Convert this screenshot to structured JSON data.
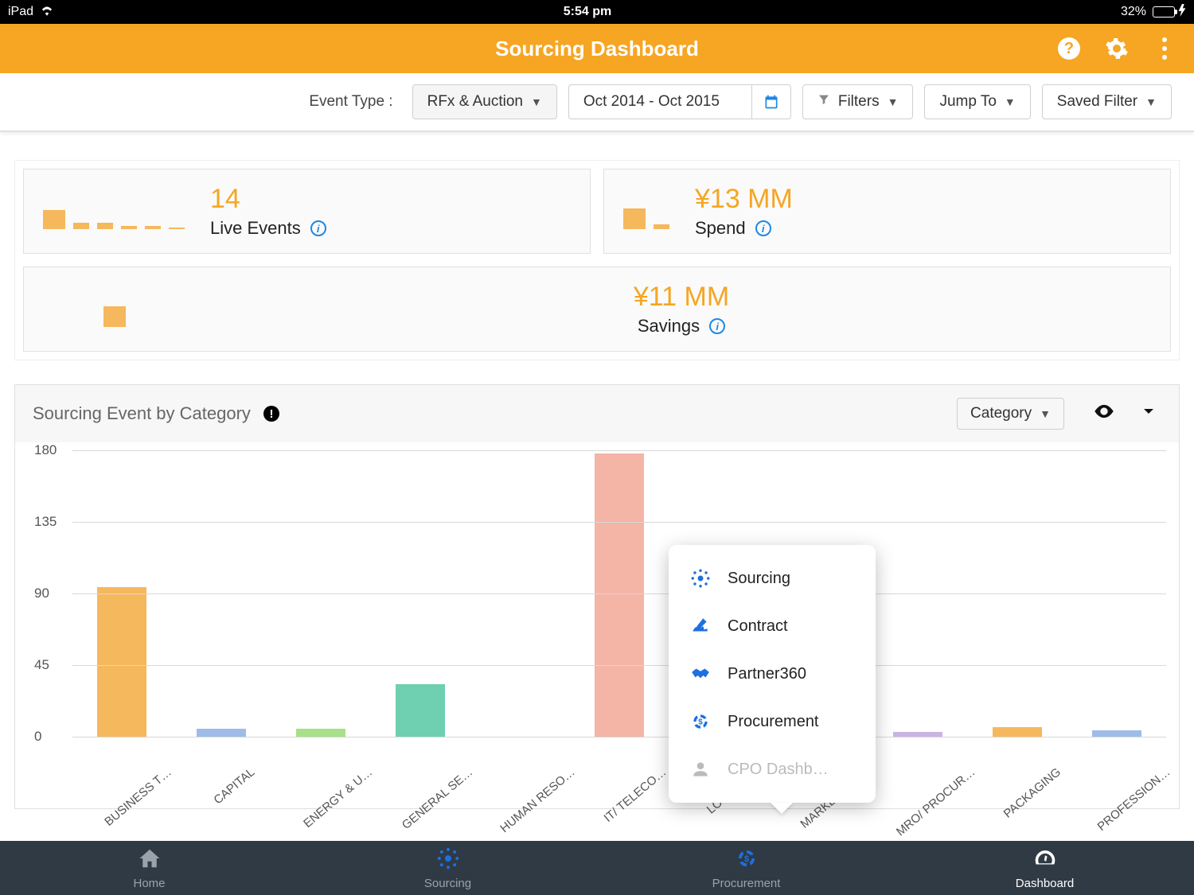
{
  "statusbar": {
    "device": "iPad",
    "time": "5:54 pm",
    "battery_pct": "32%",
    "battery_fill_pct": 32
  },
  "header": {
    "title": "Sourcing Dashboard"
  },
  "filters": {
    "event_type_label": "Event Type :",
    "event_type_value": "RFx & Auction",
    "date_range": "Oct 2014 - Oct 2015",
    "filters_label": "Filters",
    "jumpto_label": "Jump To",
    "saved_filter_label": "Saved Filter"
  },
  "kpis": {
    "live_events": {
      "value": "14",
      "label": "Live Events",
      "spark": [
        24,
        8,
        8,
        4,
        4,
        2
      ]
    },
    "spend": {
      "value": "¥13 MM",
      "label": "Spend",
      "spark": [
        26,
        6
      ]
    },
    "savings": {
      "value": "¥11 MM",
      "label": "Savings",
      "spark": [
        26
      ]
    }
  },
  "chart": {
    "title": "Sourcing Event by Category",
    "selector": "Category"
  },
  "chart_data": {
    "type": "bar",
    "ylabel": "",
    "xlabel": "",
    "ylim": [
      0,
      180
    ],
    "yticks": [
      0,
      45,
      90,
      135,
      180
    ],
    "categories": [
      "BUSINESS T…",
      "CAPITAL",
      "ENERGY & U…",
      "GENERAL SE…",
      "HUMAN RESO…",
      "IT/ TELECO…",
      "LOGISTICS",
      "MARKETING …",
      "MRO/ PROCUR…",
      "PACKAGING",
      "PROFESSION…"
    ],
    "values": [
      94,
      5,
      5,
      33,
      0,
      178,
      0,
      0,
      3,
      6,
      4
    ],
    "colors": [
      "#f5b85c",
      "#9fbce9",
      "#a8e08a",
      "#6fcfb1",
      "#ccc",
      "#f4b4a6",
      "#ccc",
      "#ccc",
      "#c9b4e3",
      "#f5b85c",
      "#9fbce9"
    ]
  },
  "popover": {
    "items": [
      {
        "label": "Sourcing",
        "icon": "hub",
        "disabled": false
      },
      {
        "label": "Contract",
        "icon": "signature",
        "disabled": false
      },
      {
        "label": "Partner360",
        "icon": "handshake",
        "disabled": false
      },
      {
        "label": "Procurement",
        "icon": "cycle",
        "disabled": false
      },
      {
        "label": "CPO Dashb…",
        "icon": "person",
        "disabled": true
      }
    ]
  },
  "bottomnav": {
    "items": [
      {
        "label": "Home",
        "icon": "home"
      },
      {
        "label": "Sourcing",
        "icon": "hub"
      },
      {
        "label": "Procurement",
        "icon": "cycle"
      },
      {
        "label": "Dashboard",
        "icon": "gauge",
        "active": true
      }
    ]
  }
}
